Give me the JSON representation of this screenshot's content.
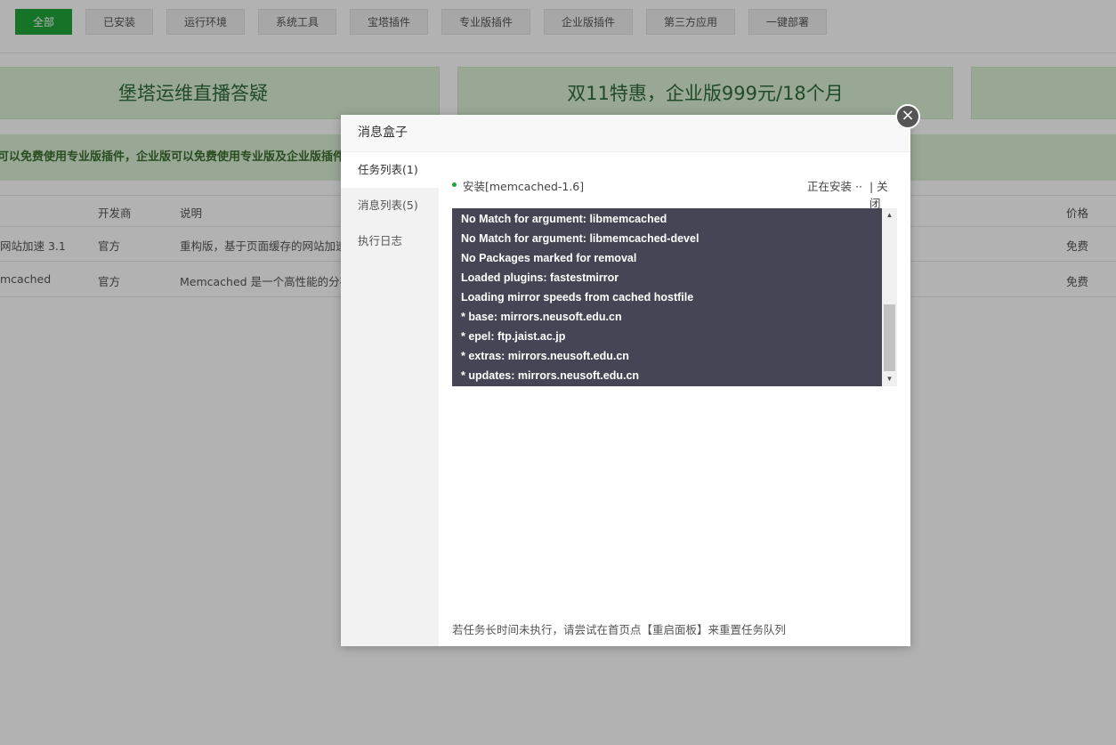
{
  "tabs": [
    "全部",
    "已安装",
    "运行环境",
    "系统工具",
    "宝塔插件",
    "专业版插件",
    "企业版插件",
    "第三方应用",
    "一键部署"
  ],
  "banners": [
    "堡塔运维直播答疑",
    "双11特惠，企业版999元/18个月"
  ],
  "notice": "可以免费使用专业版插件，企业版可以免费使用专业版及企业版插件",
  "table": {
    "headers": {
      "developer": "开发商",
      "desc": "说明",
      "price": "价格"
    },
    "rows": [
      {
        "name": "网站加速 3.1",
        "developer": "官方",
        "desc": "重构版，基于页面缓存的网站加速",
        "price": "免费"
      },
      {
        "name": "mcached",
        "developer": "官方",
        "desc": "Memcached 是一个高性能的分布",
        "price": "免费"
      }
    ]
  },
  "modal": {
    "title": "消息盒子",
    "sidebar": [
      "任务列表(1)",
      "消息列表(5)",
      "执行日志"
    ],
    "task": {
      "name": "安装[memcached-1.6]",
      "status": "正在安装 ··",
      "close": "| 关闭"
    },
    "log_lines": [
      "No Match for argument: libmemcached",
      "No Match for argument: libmemcached-devel",
      "No Packages marked for removal",
      "Loaded plugins: fastestmirror",
      "Loading mirror speeds from cached hostfile",
      "* base: mirrors.neusoft.edu.cn",
      "* epel: ftp.jaist.ac.jp",
      "* extras: mirrors.neusoft.edu.cn",
      "* updates: mirrors.neusoft.edu.cn"
    ],
    "tip": "若任务长时间未执行，请尝试在首页点【重启面板】来重置任务队列",
    "close_icon": "×"
  },
  "colors": {
    "accent": "#20a53a",
    "log_bg": "#454555",
    "banner_bg": "#dcf0d6"
  }
}
